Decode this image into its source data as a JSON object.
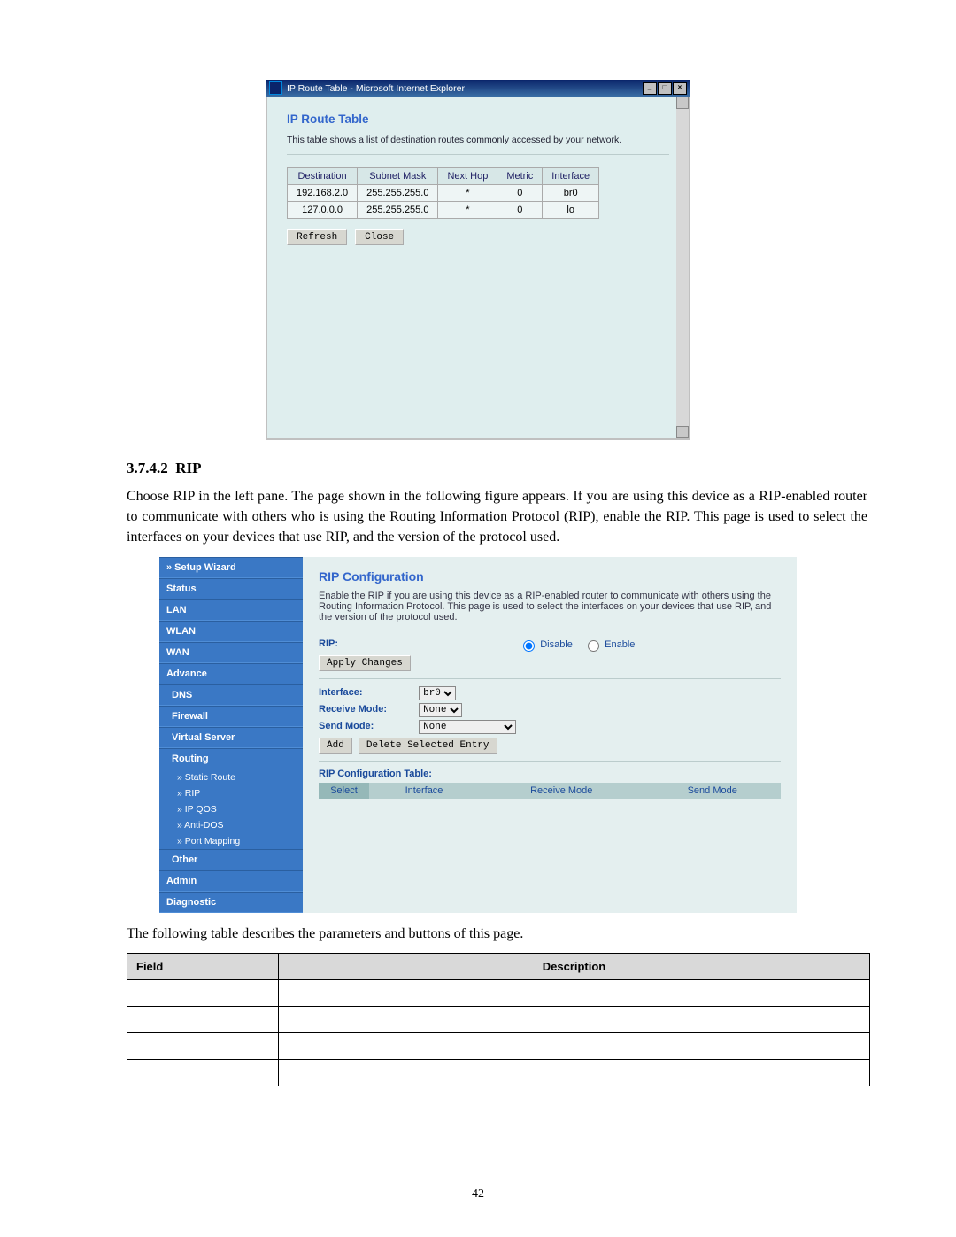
{
  "page_number": "42",
  "ie_window": {
    "title": "IP Route Table - Microsoft Internet Explorer",
    "heading": "IP Route Table",
    "description": "This table shows a list of destination routes commonly accessed by your network.",
    "columns": [
      "Destination",
      "Subnet Mask",
      "Next Hop",
      "Metric",
      "Interface"
    ],
    "rows": [
      [
        "192.168.2.0",
        "255.255.255.0",
        "*",
        "0",
        "br0"
      ],
      [
        "127.0.0.0",
        "255.255.255.0",
        "*",
        "0",
        "lo"
      ]
    ],
    "btn_refresh": "Refresh",
    "btn_close": "Close"
  },
  "section": {
    "number": "3.7.4.2",
    "title": "RIP",
    "paragraph": "Choose RIP in the left pane. The page shown in the following figure appears. If you are using this device as a RIP-enabled router to communicate with others who is using the Routing Information Protocol (RIP), enable the RIP. This page is used to select the interfaces on your devices that use RIP, and the version of the protocol used."
  },
  "sidebar": {
    "items": [
      {
        "label": "» Setup Wizard",
        "type": "cat"
      },
      {
        "label": "Status",
        "type": "cat"
      },
      {
        "label": "LAN",
        "type": "cat"
      },
      {
        "label": "WLAN",
        "type": "cat"
      },
      {
        "label": "WAN",
        "type": "cat"
      },
      {
        "label": "Advance",
        "type": "cat"
      },
      {
        "label": "DNS",
        "type": "sub"
      },
      {
        "label": "Firewall",
        "type": "sub"
      },
      {
        "label": "Virtual Server",
        "type": "sub"
      },
      {
        "label": "Routing",
        "type": "sub"
      },
      {
        "label": "» Static Route",
        "type": "leaf"
      },
      {
        "label": "» RIP",
        "type": "leaf"
      },
      {
        "label": "» IP QOS",
        "type": "leaf"
      },
      {
        "label": "» Anti-DOS",
        "type": "leaf"
      },
      {
        "label": "» Port Mapping",
        "type": "leaf"
      },
      {
        "label": "Other",
        "type": "sub"
      },
      {
        "label": "Admin",
        "type": "cat"
      },
      {
        "label": "Diagnostic",
        "type": "cat"
      }
    ]
  },
  "admin": {
    "heading": "RIP Configuration",
    "description": "Enable the RIP if you are using this device as a RIP-enabled router to communicate with others using the Routing Information Protocol. This page is used to select the interfaces on your devices that use RIP, and the version of the protocol used.",
    "rip_label": "RIP:",
    "disable": "Disable",
    "enable": "Enable",
    "apply_changes": "Apply Changes",
    "interface_label": "Interface:",
    "interface_value": "br0",
    "receive_label": "Receive Mode:",
    "receive_value": "None",
    "send_label": "Send Mode:",
    "send_value": "None",
    "add": "Add",
    "delete": "Delete Selected Entry",
    "conf_table_label": "RIP Configuration Table:",
    "conf_headers": [
      "Select",
      "Interface",
      "Receive Mode",
      "Send Mode"
    ]
  },
  "desc_intro": "The following table describes the parameters and buttons of this page.",
  "desc_table": {
    "field": "Field",
    "description": "Description"
  }
}
